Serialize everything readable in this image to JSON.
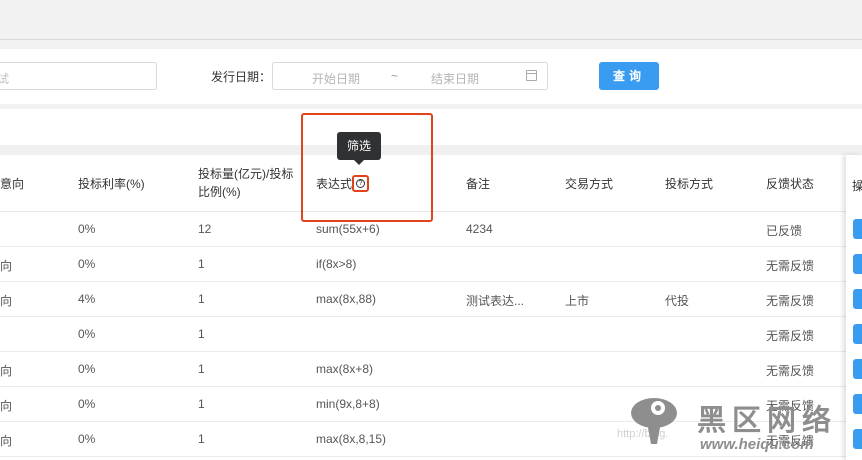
{
  "filter": {
    "keyword_placeholder": "试",
    "date_label": "发行日期：",
    "start_placeholder": "开始日期",
    "range_separator": "~",
    "end_placeholder": "结束日期",
    "query_button": "查询"
  },
  "table": {
    "headers": {
      "direction": "意向",
      "rate": "投标利率(%)",
      "amount_line1": "投标量(亿元)/投标",
      "amount_line2": "比例(%)",
      "expression": "表达式",
      "remark": "备注",
      "trade_mode": "交易方式",
      "bid_mode": "投标方式",
      "feedback": "反馈状态",
      "operation": "操"
    },
    "rows": [
      {
        "direction": "",
        "rate": "0%",
        "amount": "12",
        "expression": "sum(55x+6)",
        "remark": "4234",
        "trade_mode": "",
        "bid_mode": "",
        "feedback": "已反馈"
      },
      {
        "direction": "向",
        "rate": "0%",
        "amount": "1",
        "expression": "if(8x>8)",
        "remark": "",
        "trade_mode": "",
        "bid_mode": "",
        "feedback": "无需反馈"
      },
      {
        "direction": "向",
        "rate": "4%",
        "amount": "1",
        "expression": "max(8x,88)",
        "remark": "测试表达...",
        "trade_mode": "上市",
        "bid_mode": "代投",
        "feedback": "无需反馈"
      },
      {
        "direction": "",
        "rate": "0%",
        "amount": "1",
        "expression": "",
        "remark": "",
        "trade_mode": "",
        "bid_mode": "",
        "feedback": "无需反馈"
      },
      {
        "direction": "向",
        "rate": "0%",
        "amount": "1",
        "expression": "max(8x+8)",
        "remark": "",
        "trade_mode": "",
        "bid_mode": "",
        "feedback": "无需反馈"
      },
      {
        "direction": "向",
        "rate": "0%",
        "amount": "1",
        "expression": "min(9x,8+8)",
        "remark": "",
        "trade_mode": "",
        "bid_mode": "",
        "feedback": "无需反馈"
      },
      {
        "direction": "向",
        "rate": "0%",
        "amount": "1",
        "expression": "max(8x,8,15)",
        "remark": "",
        "trade_mode": "",
        "bid_mode": "",
        "feedback": "无需反馈"
      }
    ]
  },
  "tooltip": {
    "text": "筛选"
  },
  "help_icon": "?",
  "watermark": {
    "faint_text": "http://blog.",
    "big_text": "黑区网络",
    "url": "www.heiqu.com"
  },
  "colors": {
    "primary": "#3a9cf0",
    "highlight": "#e0441c",
    "tooltip_bg": "#303133"
  }
}
